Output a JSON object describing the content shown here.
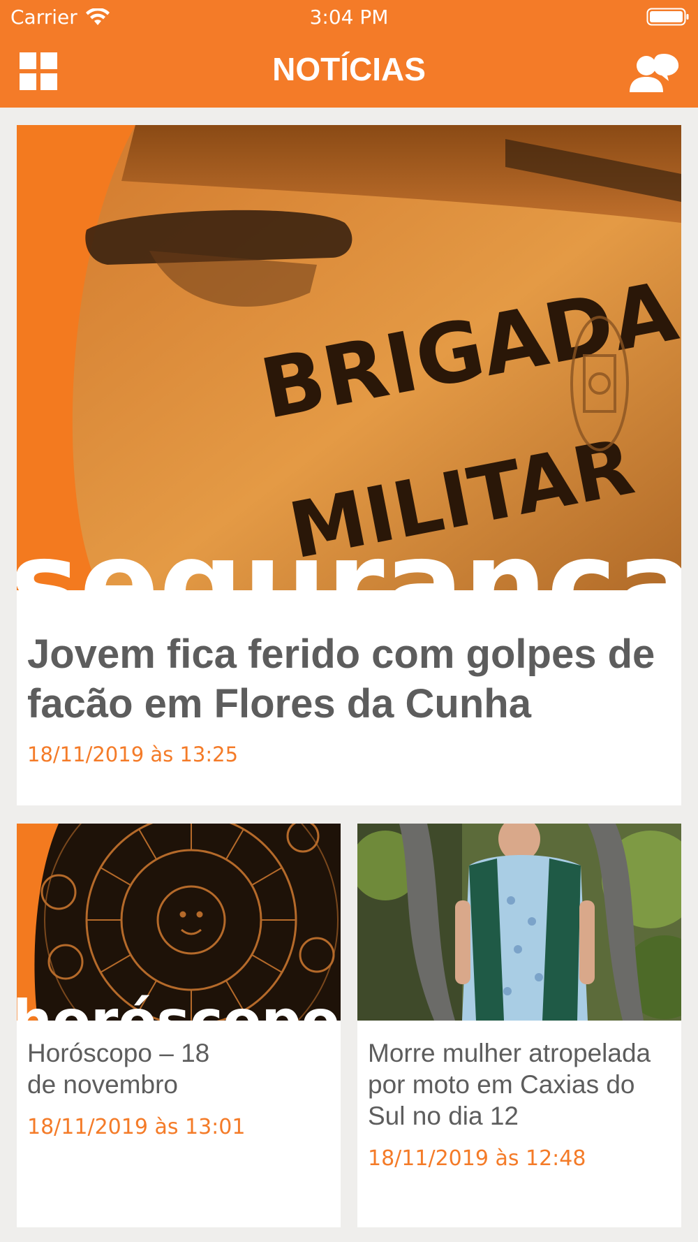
{
  "status_bar": {
    "carrier": "Carrier",
    "time": "3:04 PM"
  },
  "header": {
    "title": "NOTÍCIAS",
    "menu_icon": "grid-menu-icon",
    "profile_icon": "users-chat-icon",
    "background_color": "#f47b28"
  },
  "articles": [
    {
      "title": "Jovem fica ferido com golpes de facão em Flores da Cunha",
      "date": "18/11/2019 às 13:25",
      "image": {
        "description_text_top": "BRIGADA",
        "description_text_bottom": "MILITAR",
        "banner_word": "segurança"
      }
    },
    {
      "title": "Horóscopo – 18 de novembro",
      "date": "18/11/2019 às 13:01",
      "image": {
        "banner_word": "horóscopo"
      }
    },
    {
      "title": "Morre mulher atropelada por moto em Caxias do Sul no dia 12",
      "date": "18/11/2019 às 12:48"
    }
  ],
  "colors": {
    "accent": "#f47b28",
    "headline": "#5d5d5d",
    "background": "#efeeec",
    "card": "#ffffff"
  }
}
